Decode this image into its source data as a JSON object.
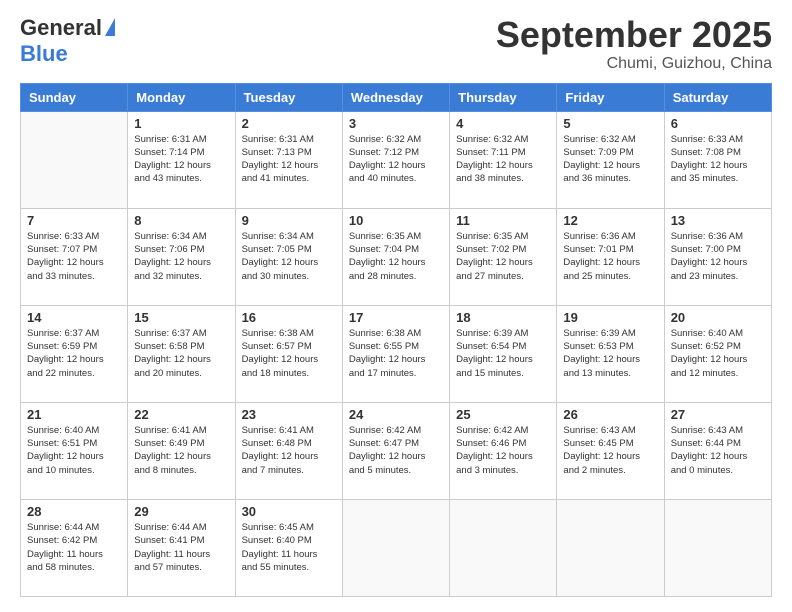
{
  "logo": {
    "general": "General",
    "blue": "Blue"
  },
  "header": {
    "month": "September 2025",
    "location": "Chumi, Guizhou, China"
  },
  "weekdays": [
    "Sunday",
    "Monday",
    "Tuesday",
    "Wednesday",
    "Thursday",
    "Friday",
    "Saturday"
  ],
  "weeks": [
    [
      {
        "day": "",
        "sunrise": "",
        "sunset": "",
        "daylight": ""
      },
      {
        "day": "1",
        "sunrise": "Sunrise: 6:31 AM",
        "sunset": "Sunset: 7:14 PM",
        "daylight": "Daylight: 12 hours and 43 minutes."
      },
      {
        "day": "2",
        "sunrise": "Sunrise: 6:31 AM",
        "sunset": "Sunset: 7:13 PM",
        "daylight": "Daylight: 12 hours and 41 minutes."
      },
      {
        "day": "3",
        "sunrise": "Sunrise: 6:32 AM",
        "sunset": "Sunset: 7:12 PM",
        "daylight": "Daylight: 12 hours and 40 minutes."
      },
      {
        "day": "4",
        "sunrise": "Sunrise: 6:32 AM",
        "sunset": "Sunset: 7:11 PM",
        "daylight": "Daylight: 12 hours and 38 minutes."
      },
      {
        "day": "5",
        "sunrise": "Sunrise: 6:32 AM",
        "sunset": "Sunset: 7:09 PM",
        "daylight": "Daylight: 12 hours and 36 minutes."
      },
      {
        "day": "6",
        "sunrise": "Sunrise: 6:33 AM",
        "sunset": "Sunset: 7:08 PM",
        "daylight": "Daylight: 12 hours and 35 minutes."
      }
    ],
    [
      {
        "day": "7",
        "sunrise": "Sunrise: 6:33 AM",
        "sunset": "Sunset: 7:07 PM",
        "daylight": "Daylight: 12 hours and 33 minutes."
      },
      {
        "day": "8",
        "sunrise": "Sunrise: 6:34 AM",
        "sunset": "Sunset: 7:06 PM",
        "daylight": "Daylight: 12 hours and 32 minutes."
      },
      {
        "day": "9",
        "sunrise": "Sunrise: 6:34 AM",
        "sunset": "Sunset: 7:05 PM",
        "daylight": "Daylight: 12 hours and 30 minutes."
      },
      {
        "day": "10",
        "sunrise": "Sunrise: 6:35 AM",
        "sunset": "Sunset: 7:04 PM",
        "daylight": "Daylight: 12 hours and 28 minutes."
      },
      {
        "day": "11",
        "sunrise": "Sunrise: 6:35 AM",
        "sunset": "Sunset: 7:02 PM",
        "daylight": "Daylight: 12 hours and 27 minutes."
      },
      {
        "day": "12",
        "sunrise": "Sunrise: 6:36 AM",
        "sunset": "Sunset: 7:01 PM",
        "daylight": "Daylight: 12 hours and 25 minutes."
      },
      {
        "day": "13",
        "sunrise": "Sunrise: 6:36 AM",
        "sunset": "Sunset: 7:00 PM",
        "daylight": "Daylight: 12 hours and 23 minutes."
      }
    ],
    [
      {
        "day": "14",
        "sunrise": "Sunrise: 6:37 AM",
        "sunset": "Sunset: 6:59 PM",
        "daylight": "Daylight: 12 hours and 22 minutes."
      },
      {
        "day": "15",
        "sunrise": "Sunrise: 6:37 AM",
        "sunset": "Sunset: 6:58 PM",
        "daylight": "Daylight: 12 hours and 20 minutes."
      },
      {
        "day": "16",
        "sunrise": "Sunrise: 6:38 AM",
        "sunset": "Sunset: 6:57 PM",
        "daylight": "Daylight: 12 hours and 18 minutes."
      },
      {
        "day": "17",
        "sunrise": "Sunrise: 6:38 AM",
        "sunset": "Sunset: 6:55 PM",
        "daylight": "Daylight: 12 hours and 17 minutes."
      },
      {
        "day": "18",
        "sunrise": "Sunrise: 6:39 AM",
        "sunset": "Sunset: 6:54 PM",
        "daylight": "Daylight: 12 hours and 15 minutes."
      },
      {
        "day": "19",
        "sunrise": "Sunrise: 6:39 AM",
        "sunset": "Sunset: 6:53 PM",
        "daylight": "Daylight: 12 hours and 13 minutes."
      },
      {
        "day": "20",
        "sunrise": "Sunrise: 6:40 AM",
        "sunset": "Sunset: 6:52 PM",
        "daylight": "Daylight: 12 hours and 12 minutes."
      }
    ],
    [
      {
        "day": "21",
        "sunrise": "Sunrise: 6:40 AM",
        "sunset": "Sunset: 6:51 PM",
        "daylight": "Daylight: 12 hours and 10 minutes."
      },
      {
        "day": "22",
        "sunrise": "Sunrise: 6:41 AM",
        "sunset": "Sunset: 6:49 PM",
        "daylight": "Daylight: 12 hours and 8 minutes."
      },
      {
        "day": "23",
        "sunrise": "Sunrise: 6:41 AM",
        "sunset": "Sunset: 6:48 PM",
        "daylight": "Daylight: 12 hours and 7 minutes."
      },
      {
        "day": "24",
        "sunrise": "Sunrise: 6:42 AM",
        "sunset": "Sunset: 6:47 PM",
        "daylight": "Daylight: 12 hours and 5 minutes."
      },
      {
        "day": "25",
        "sunrise": "Sunrise: 6:42 AM",
        "sunset": "Sunset: 6:46 PM",
        "daylight": "Daylight: 12 hours and 3 minutes."
      },
      {
        "day": "26",
        "sunrise": "Sunrise: 6:43 AM",
        "sunset": "Sunset: 6:45 PM",
        "daylight": "Daylight: 12 hours and 2 minutes."
      },
      {
        "day": "27",
        "sunrise": "Sunrise: 6:43 AM",
        "sunset": "Sunset: 6:44 PM",
        "daylight": "Daylight: 12 hours and 0 minutes."
      }
    ],
    [
      {
        "day": "28",
        "sunrise": "Sunrise: 6:44 AM",
        "sunset": "Sunset: 6:42 PM",
        "daylight": "Daylight: 11 hours and 58 minutes."
      },
      {
        "day": "29",
        "sunrise": "Sunrise: 6:44 AM",
        "sunset": "Sunset: 6:41 PM",
        "daylight": "Daylight: 11 hours and 57 minutes."
      },
      {
        "day": "30",
        "sunrise": "Sunrise: 6:45 AM",
        "sunset": "Sunset: 6:40 PM",
        "daylight": "Daylight: 11 hours and 55 minutes."
      },
      {
        "day": "",
        "sunrise": "",
        "sunset": "",
        "daylight": ""
      },
      {
        "day": "",
        "sunrise": "",
        "sunset": "",
        "daylight": ""
      },
      {
        "day": "",
        "sunrise": "",
        "sunset": "",
        "daylight": ""
      },
      {
        "day": "",
        "sunrise": "",
        "sunset": "",
        "daylight": ""
      }
    ]
  ]
}
